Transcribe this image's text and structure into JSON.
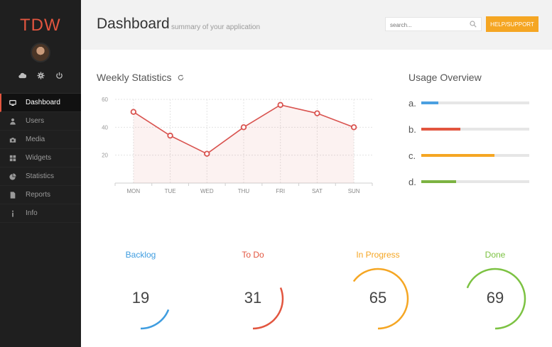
{
  "sidebar": {
    "brand": "TDW",
    "items": [
      {
        "label": "Dashboard",
        "icon": "monitor-icon",
        "active": true
      },
      {
        "label": "Users",
        "icon": "user-icon",
        "active": false
      },
      {
        "label": "Media",
        "icon": "camera-icon",
        "active": false
      },
      {
        "label": "Widgets",
        "icon": "grid-icon",
        "active": false
      },
      {
        "label": "Statistics",
        "icon": "pie-chart-icon",
        "active": false
      },
      {
        "label": "Reports",
        "icon": "document-icon",
        "active": false
      },
      {
        "label": "Info",
        "icon": "info-icon",
        "active": false
      }
    ]
  },
  "header": {
    "title": "Dashboard",
    "subtitle": "summary of your application",
    "search_placeholder": "search...",
    "support_label": "HELP/SUPPORT"
  },
  "weekly": {
    "title": "Weekly Statistics"
  },
  "chart_data": {
    "type": "area",
    "categories": [
      "MON",
      "TUE",
      "WED",
      "THU",
      "FRI",
      "SAT",
      "SUN"
    ],
    "values": [
      51,
      34,
      21,
      40,
      56,
      50,
      40
    ],
    "yticks": [
      20,
      40,
      60
    ],
    "ylim": [
      0,
      60
    ],
    "grid": true,
    "color": "#d9534f"
  },
  "usage": {
    "title": "Usage Overview",
    "rows": [
      {
        "label": "a.",
        "fraction": 0.16,
        "color": "#4a9fe0"
      },
      {
        "label": "b.",
        "fraction": 0.36,
        "color": "#e2553f"
      },
      {
        "label": "c.",
        "fraction": 0.68,
        "color": "#f5a623"
      },
      {
        "label": "d.",
        "fraction": 0.32,
        "color": "#7cb342"
      }
    ]
  },
  "gauges": [
    {
      "label": "Backlog",
      "value": "19",
      "fraction": 0.19,
      "color": "#3f9de0"
    },
    {
      "label": "To Do",
      "value": "31",
      "fraction": 0.31,
      "color": "#e2553f"
    },
    {
      "label": "In Progress",
      "value": "65",
      "fraction": 0.65,
      "color": "#f5a623"
    },
    {
      "label": "Done",
      "value": "69",
      "fraction": 0.69,
      "color": "#7cc242"
    }
  ]
}
